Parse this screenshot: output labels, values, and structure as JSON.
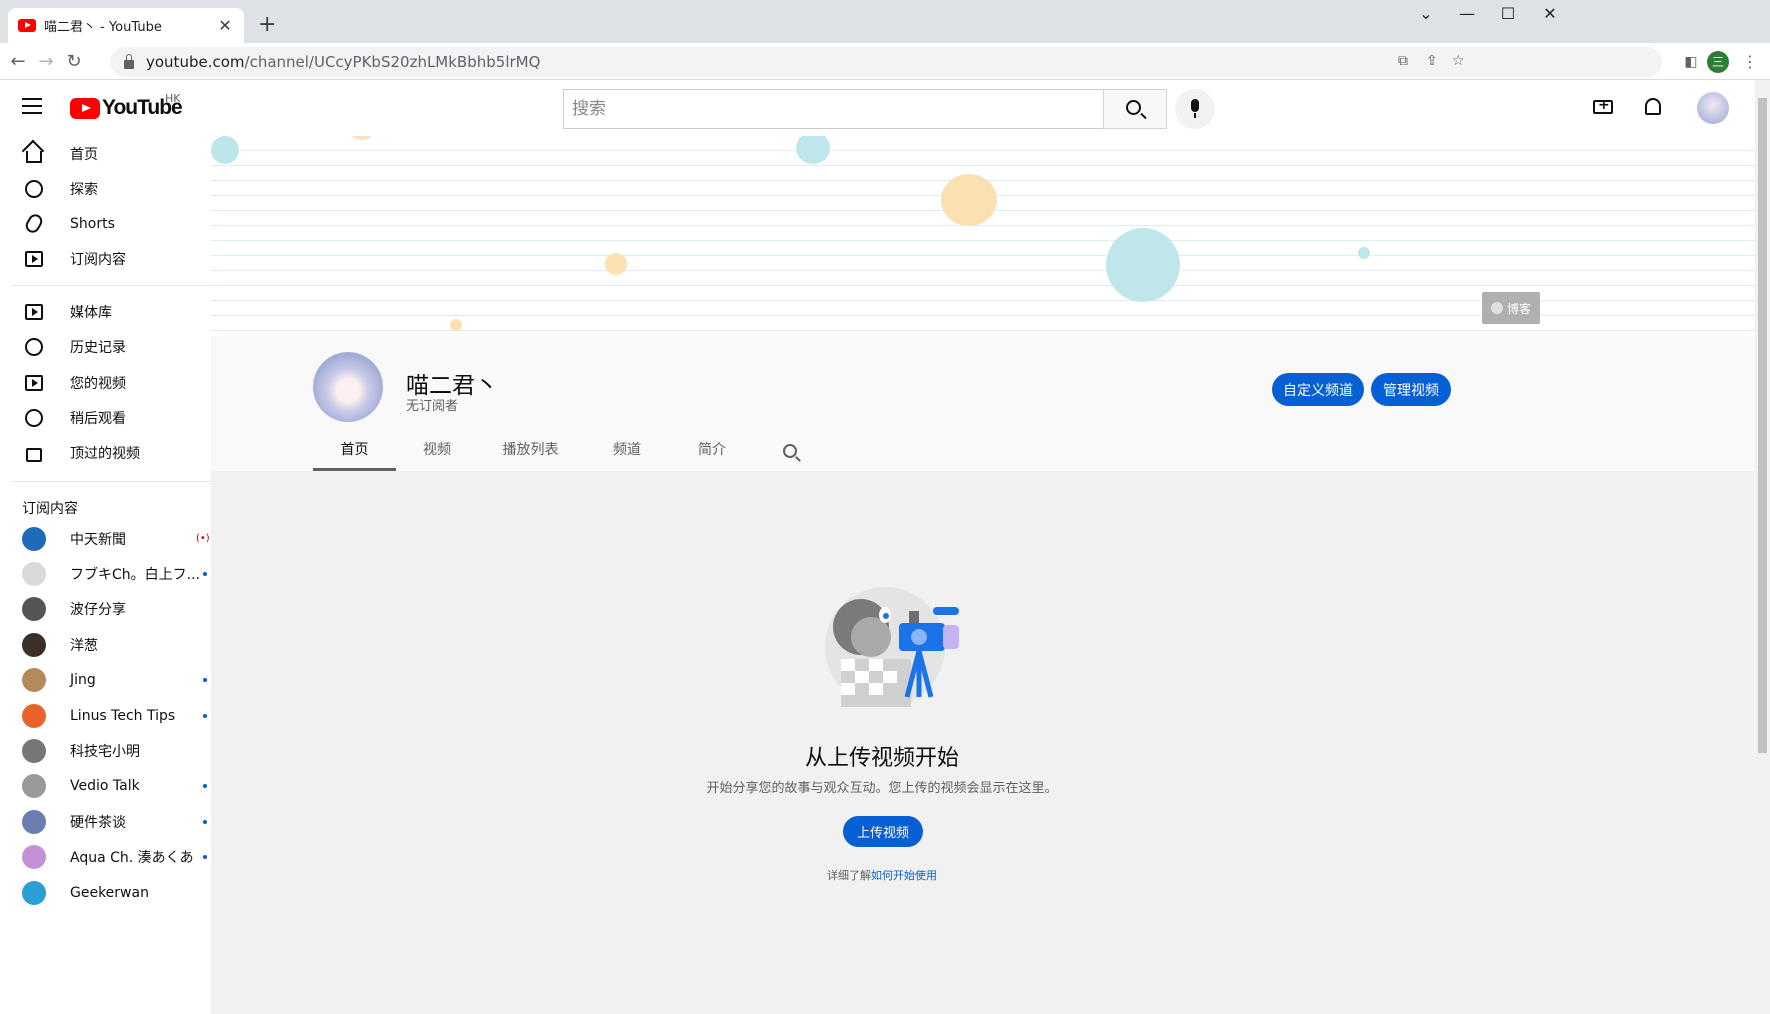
{
  "browser": {
    "tab_title": "喵二君丶 - YouTube",
    "tab_close": "✕",
    "new_tab": "+",
    "url_host": "youtube.com",
    "url_path": "/channel/UCcyPKbS20zhLMkBbhb5lrMQ",
    "profile_initial": "三",
    "win_minimize": "—",
    "win_maximize": "☐",
    "win_close": "✕",
    "win_dropdown": "⌄"
  },
  "header": {
    "logo_text": "YouTube",
    "region": "HK",
    "search_placeholder": "搜索"
  },
  "sidebar": {
    "main": [
      {
        "label": "首页",
        "icon": "home-icon"
      },
      {
        "label": "探索",
        "icon": "compass-icon"
      },
      {
        "label": "Shorts",
        "icon": "shorts-icon"
      },
      {
        "label": "订阅内容",
        "icon": "subscriptions-icon"
      }
    ],
    "library": [
      {
        "label": "媒体库",
        "icon": "library-icon"
      },
      {
        "label": "历史记录",
        "icon": "history-icon"
      },
      {
        "label": "您的视频",
        "icon": "your-videos-icon"
      },
      {
        "label": "稍后观看",
        "icon": "watch-later-icon"
      },
      {
        "label": "顶过的视频",
        "icon": "liked-icon"
      }
    ],
    "subscriptions_heading": "订阅内容",
    "subscriptions": [
      {
        "label": "中天新聞",
        "status": "live",
        "color": "#1e6bb8"
      },
      {
        "label": "フブキCh。白上フ...",
        "status": "new",
        "color": "#d9d9d9"
      },
      {
        "label": "波仔分享",
        "status": "none",
        "color": "#555555"
      },
      {
        "label": "洋葱",
        "status": "none",
        "color": "#3a2f2a"
      },
      {
        "label": "Jing",
        "status": "new",
        "color": "#b48a5a"
      },
      {
        "label": "Linus Tech Tips",
        "status": "new",
        "color": "#e8632c"
      },
      {
        "label": "科技宅小明",
        "status": "none",
        "color": "#777777"
      },
      {
        "label": "Vedio Talk",
        "status": "new",
        "color": "#999999"
      },
      {
        "label": "硬件茶谈",
        "status": "new",
        "color": "#6a7fb0"
      },
      {
        "label": "Aqua Ch. 湊あくあ",
        "status": "new",
        "color": "#c68fd6"
      },
      {
        "label": "Geekerwan",
        "status": "none",
        "color": "#2a9fd6"
      }
    ],
    "live_glyph": "(•)"
  },
  "banner": {
    "blog_badge": "博客"
  },
  "channel": {
    "name": "喵二君丶",
    "subscribers": "无订阅者",
    "customize_button": "自定义频道",
    "manage_button": "管理视频",
    "tabs": [
      "首页",
      "视频",
      "播放列表",
      "频道",
      "简介"
    ],
    "active_tab": 0
  },
  "empty_state": {
    "title": "从上传视频开始",
    "description": "开始分享您的故事与观众互动。您上传的视频会显示在这里。",
    "upload_button": "上传视频",
    "learn_prefix": "详细了解",
    "learn_link": "如何开始使用"
  },
  "colors": {
    "accent": "#065fd4",
    "youtube_red": "#ff0000"
  }
}
